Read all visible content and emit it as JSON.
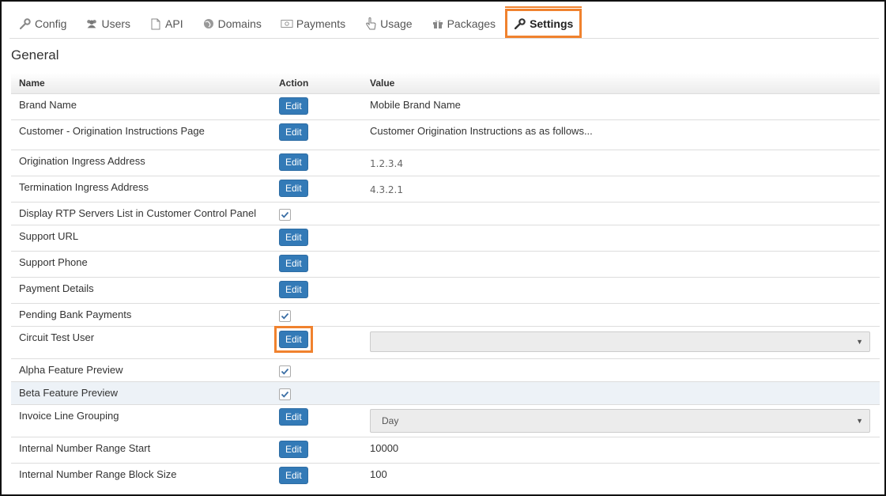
{
  "tabs": [
    {
      "label": "Config",
      "icon": "wrench-icon"
    },
    {
      "label": "Users",
      "icon": "users-icon"
    },
    {
      "label": "API",
      "icon": "file-icon"
    },
    {
      "label": "Domains",
      "icon": "globe-icon"
    },
    {
      "label": "Payments",
      "icon": "money-icon"
    },
    {
      "label": "Usage",
      "icon": "hand-pointer-icon"
    },
    {
      "label": "Packages",
      "icon": "gift-icon"
    },
    {
      "label": "Settings",
      "icon": "wrench-icon",
      "active": true
    }
  ],
  "section_title": "General",
  "columns": {
    "name": "Name",
    "action": "Action",
    "value": "Value"
  },
  "edit_label": "Edit",
  "rows": [
    {
      "name": "Brand Name",
      "action": "edit",
      "value": "Mobile Brand Name"
    },
    {
      "name": "Customer - Origination Instructions Page",
      "action": "edit",
      "value": "Customer Origination Instructions as as follows..."
    },
    {
      "name": "Origination Ingress Address",
      "action": "edit",
      "value": "1.2.3.4"
    },
    {
      "name": "Termination Ingress Address",
      "action": "edit",
      "value": "4.3.2.1"
    },
    {
      "name": "Display RTP Servers List in Customer Control Panel",
      "action": "checkbox",
      "checked": true
    },
    {
      "name": "Support URL",
      "action": "edit",
      "value": ""
    },
    {
      "name": "Support Phone",
      "action": "edit",
      "value": ""
    },
    {
      "name": "Payment Details",
      "action": "edit",
      "value": ""
    },
    {
      "name": "Pending Bank Payments",
      "action": "checkbox",
      "checked": true
    },
    {
      "name": "Circuit Test User",
      "action": "edit",
      "value_select": ""
    },
    {
      "name": "Alpha Feature Preview",
      "action": "checkbox",
      "checked": true
    },
    {
      "name": "Beta Feature Preview",
      "action": "checkbox",
      "checked": true
    },
    {
      "name": "Invoice Line Grouping",
      "action": "edit",
      "value_select": "Day"
    },
    {
      "name": "Internal Number Range Start",
      "action": "edit",
      "value": "10000"
    },
    {
      "name": "Internal Number Range Block Size",
      "action": "edit",
      "value": "100"
    }
  ],
  "colors": {
    "accent": "#f0822e",
    "button": "#337ab7",
    "highlight_row": "#edf2f7"
  }
}
